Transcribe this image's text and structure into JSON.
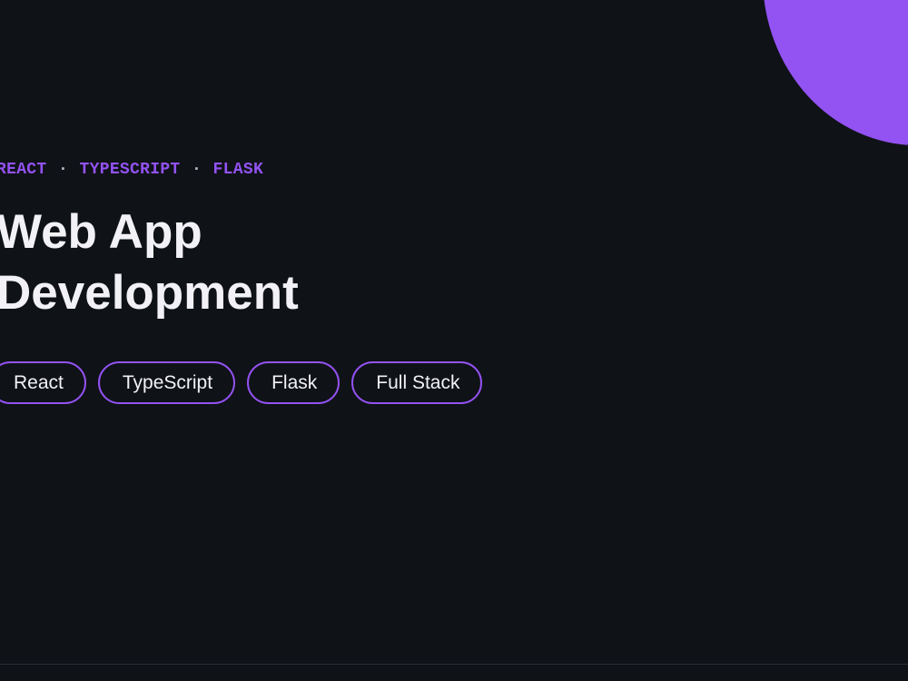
{
  "hero": {
    "tech_line": [
      "REACT",
      "TYPESCRIPT",
      "FLASK"
    ],
    "separator": "·",
    "title_line1": "Web App",
    "title_line2": "Development"
  },
  "tags": [
    "React",
    "TypeScript",
    "Flask",
    "Full Stack"
  ],
  "colors": {
    "background": "#0f1217",
    "accent": "#9352f2",
    "text": "#f2f2f6"
  }
}
